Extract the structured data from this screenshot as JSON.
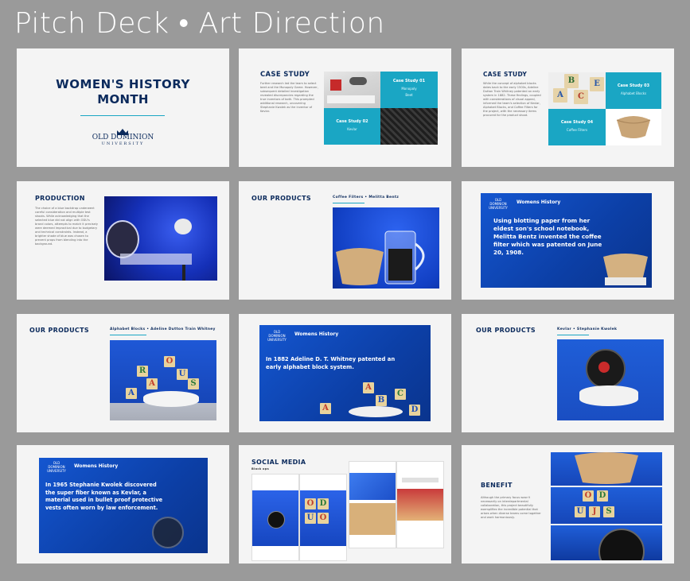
{
  "page": {
    "title": "Pitch Deck • Art Direction"
  },
  "slides": {
    "s1": {
      "title_line1": "WOMEN'S HISTORY",
      "title_line2": "MONTH",
      "logo_line1": "OLD DOMINION",
      "logo_line2": "UNIVERSITY"
    },
    "s2": {
      "heading": "CASE STUDY",
      "body": "Further research led the team to select beet and the Monopoly Game. However, subsequent detailed investigation revealed discrepancies regarding the true inventors of both. This prompted additional research, uncovering Stephanie Kwolek as the inventor of Kevlar.",
      "cs1_title": "Case Study 01",
      "cs1_sub_line1": "Monopoly",
      "cs1_sub_line2": "Beet",
      "cs2_title": "Case Study 02",
      "cs2_sub": "Kevlar"
    },
    "s3": {
      "heading": "CASE STUDY",
      "body": "While the concept of alphabet blocks dates back to the early 1500s, Adeline Dutton Train Whitney patented an early system in 1882. These findings, coupled with considerations of visual appeal, informed the team's selection of Kevlar, Alphabet Blocks, and Coffee Filters for the project, with the necessary items procured for the product shoot.",
      "cs3_title": "Case Study 03",
      "cs3_sub": "Alphabet Blocks",
      "cs4_title": "Case Study 04",
      "cs4_sub": "Coffee Filters"
    },
    "s4": {
      "heading": "PRODUCTION",
      "body": "The choice of a blue backdrop underwent careful consideration and multiple test shoots. While acknowledging that the selected blue did not align with ODU's brand colors, attempts to match it precisely were deemed impractical due to budgetary and technical constraints. Instead, a brighter shade of blue was chosen to prevent props from blending into the background."
    },
    "s5": {
      "heading": "OUR PRODUCTS",
      "subtitle": "Coffee Filters • Melitta Bentz"
    },
    "s6": {
      "logo_line1": "OLD DOMINION",
      "logo_line2": "UNIVERSITY",
      "label": "Womens History",
      "text": "Using blotting paper from her eldest son's school notebook, Melitta Bentz invented the coffee filter which was patented on June 20, 1908."
    },
    "s7": {
      "heading": "OUR PRODUCTS",
      "subtitle": "Alphabet Blocks • Adeline Dutton Train Whitney"
    },
    "s8": {
      "logo_line1": "OLD DOMINION",
      "logo_line2": "UNIVERSITY",
      "label": "Womens History",
      "text": "In 1882 Adeline D. T. Whitney patented an early alphabet block system."
    },
    "s9": {
      "heading": "OUR PRODUCTS",
      "subtitle": "Kevlar • Stephanie Kwolek"
    },
    "s10": {
      "logo_line1": "OLD DOMINION",
      "logo_line2": "UNIVERSITY",
      "label": "Womens History",
      "text": "In 1965 Stephanie Kwolek discovered the super fiber known as Kevlar, a material used in bullet proof protective vests often worn by law enforcement."
    },
    "s11": {
      "heading": "SOCIAL MEDIA",
      "subtitle": "Block ops"
    },
    "s12": {
      "heading": "BENEFIT",
      "body": "Although the primary focus wasn't necessarily on interdepartmental collaboration, this project beautifully exemplifies the incredible potential that arises when diverse teams come together and work harmoniously."
    }
  },
  "colors": {
    "navy": "#0b2a5c",
    "teal": "#1aa6c4",
    "blue": "#1456d0",
    "background": "#9a9a9a"
  },
  "icons": [
    "crown-icon",
    "blue-studio-photo",
    "coffee-filter-photo",
    "alphabet-blocks-photo",
    "kevlar-spool-photo"
  ]
}
